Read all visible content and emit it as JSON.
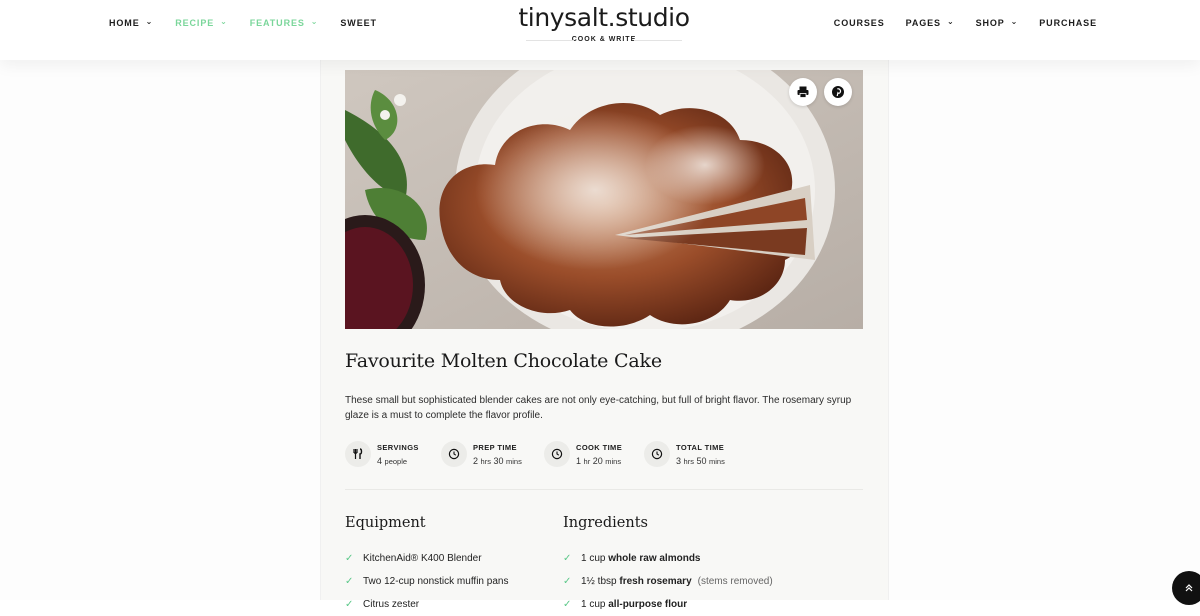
{
  "nav": {
    "left": [
      {
        "label": "HOME",
        "dropdown": true,
        "active": false
      },
      {
        "label": "RECIPE",
        "dropdown": true,
        "active": true
      },
      {
        "label": "FEATURES",
        "dropdown": true,
        "active": true
      },
      {
        "label": "SWEET",
        "dropdown": false,
        "active": false
      }
    ],
    "right": [
      {
        "label": "COURSES",
        "dropdown": false
      },
      {
        "label": "PAGES",
        "dropdown": true
      },
      {
        "label": "SHOP",
        "dropdown": true
      },
      {
        "label": "PURCHASE",
        "dropdown": false
      }
    ],
    "accent_color": "#7ad69a"
  },
  "brand": {
    "title": "tinysalt.studio",
    "subtitle": "COOK & WRITE"
  },
  "hero": {
    "icons": [
      "print-icon",
      "pinterest-icon"
    ]
  },
  "recipe": {
    "title": "Favourite Molten Chocolate Cake",
    "description": "These small but sophisticated blender cakes are not only eye-catching, but full of bright flavor. The rosemary syrup glaze is a must to complete the flavor profile.",
    "meta": {
      "servings": {
        "label": "SERVINGS",
        "value": "4",
        "unit": "people",
        "icon": "fork-knife-icon"
      },
      "prep": {
        "label": "PREP TIME",
        "v1": "2",
        "u1": "hrs",
        "v2": "30",
        "u2": "mins",
        "icon": "clock-icon"
      },
      "cook": {
        "label": "COOK TIME",
        "v1": "1",
        "u1": "hr",
        "v2": "20",
        "u2": "mins",
        "icon": "clock-icon"
      },
      "total": {
        "label": "TOTAL TIME",
        "v1": "3",
        "u1": "hrs",
        "v2": "50",
        "u2": "mins",
        "icon": "clock-icon"
      }
    }
  },
  "equipment": {
    "title": "Equipment",
    "items": [
      "KitchenAid® K400 Blender",
      "Two 12-cup nonstick muffin pans",
      "Citrus zester"
    ]
  },
  "ingredients": {
    "title": "Ingredients",
    "items": [
      {
        "amount": "1 cup",
        "name": "whole raw almonds",
        "note": ""
      },
      {
        "amount": "1½ tbsp",
        "name": "fresh rosemary",
        "note": "(stems removed)"
      },
      {
        "amount": "1 cup",
        "name": "all-purpose flour",
        "note": ""
      }
    ]
  },
  "scroll_top": {
    "icon": "double-chevron-up-icon"
  }
}
